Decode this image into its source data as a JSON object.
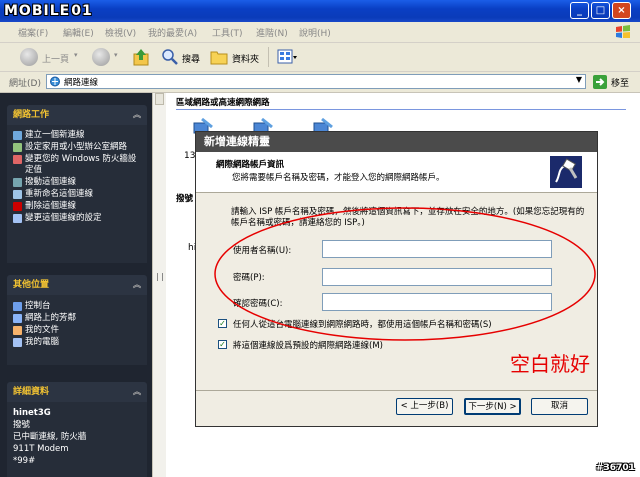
{
  "window": {
    "logo_text": "MOBILE",
    "logo_digits": "01",
    "buttons": [
      "_",
      "□",
      "×"
    ]
  },
  "menu": [
    "檔案(F)",
    "編輯(E)",
    "檢視(V)",
    "我的最愛(A)",
    "工具(T)",
    "進階(N)",
    "說明(H)"
  ],
  "toolbar": {
    "back": "上一頁",
    "search": "搜尋",
    "folders": "資料夾"
  },
  "address": {
    "label": "網址(D)",
    "value": "網路連線",
    "go": "移至"
  },
  "left": {
    "network_tasks": {
      "title": "網路工作",
      "items": [
        {
          "text": "建立一個新連線",
          "icon_color": "#6fa8dc"
        },
        {
          "text": "設定家用或小型辦公室網路",
          "icon_color": "#93c47d"
        },
        {
          "text": "變更您的 Windows 防火牆設定值",
          "icon_color": "#e06666"
        },
        {
          "text": "撥動這個連線",
          "icon_color": "#76a5af"
        },
        {
          "text": "重新命名這個連線",
          "icon_color": "#9fc5e8"
        },
        {
          "text": "刪除這個連線",
          "icon_color": "#cc0000"
        },
        {
          "text": "變更這個連線的設定",
          "icon_color": "#a4c2f4"
        }
      ]
    },
    "other_places": {
      "title": "其他位置",
      "items": [
        {
          "text": "控制台",
          "icon_color": "#6d9eeb"
        },
        {
          "text": "網路上的芳鄰",
          "icon_color": "#8ab4f8"
        },
        {
          "text": "我的文件",
          "icon_color": "#f6b26b"
        },
        {
          "text": "我的電腦",
          "icon_color": "#a4c2f4"
        }
      ]
    },
    "details": {
      "title": "詳細資料",
      "name": "hinet3G",
      "lines": [
        "撥號",
        "已中斷連線, 防火牆",
        "911T Modem",
        "*99#"
      ]
    }
  },
  "content": {
    "section1": "區域網路或高速網際網路",
    "section2": "撥號",
    "icon_label1": "13",
    "icon_label2": "hi"
  },
  "dialog": {
    "title": "新增連線精靈",
    "head_title": "網際網路帳戶資訊",
    "head_sub": "您將需要帳戶名稱及密碼，才能登入您的網際網路帳戶。",
    "intro": "請輸入 ISP 帳戶名稱及密碼，然後將這個資訊寫下，並存放在安全的地方。(如果您忘記現有的帳戶名稱或密碼，請連絡您的 ISP。)",
    "user_label": "使用者名稱(U):",
    "password_label": "密碼(P):",
    "confirm_label": "確認密碼(C):",
    "user_value": "",
    "password_value": "",
    "confirm_value": "",
    "checkbox1": "任何人從這台電腦連線到網際網路時，都使用這個帳戶名稱和密碼(S)",
    "checkbox2": "將這個連線設爲預設的網際網路連線(M)",
    "checkbox1_checked": true,
    "checkbox2_checked": true,
    "back_btn": "< 上一步(B)",
    "next_btn": "下一步(N) >",
    "cancel_btn": "取消"
  },
  "annotation": {
    "text": "空白就好",
    "color": "#e60000"
  },
  "watermark": "#36701"
}
